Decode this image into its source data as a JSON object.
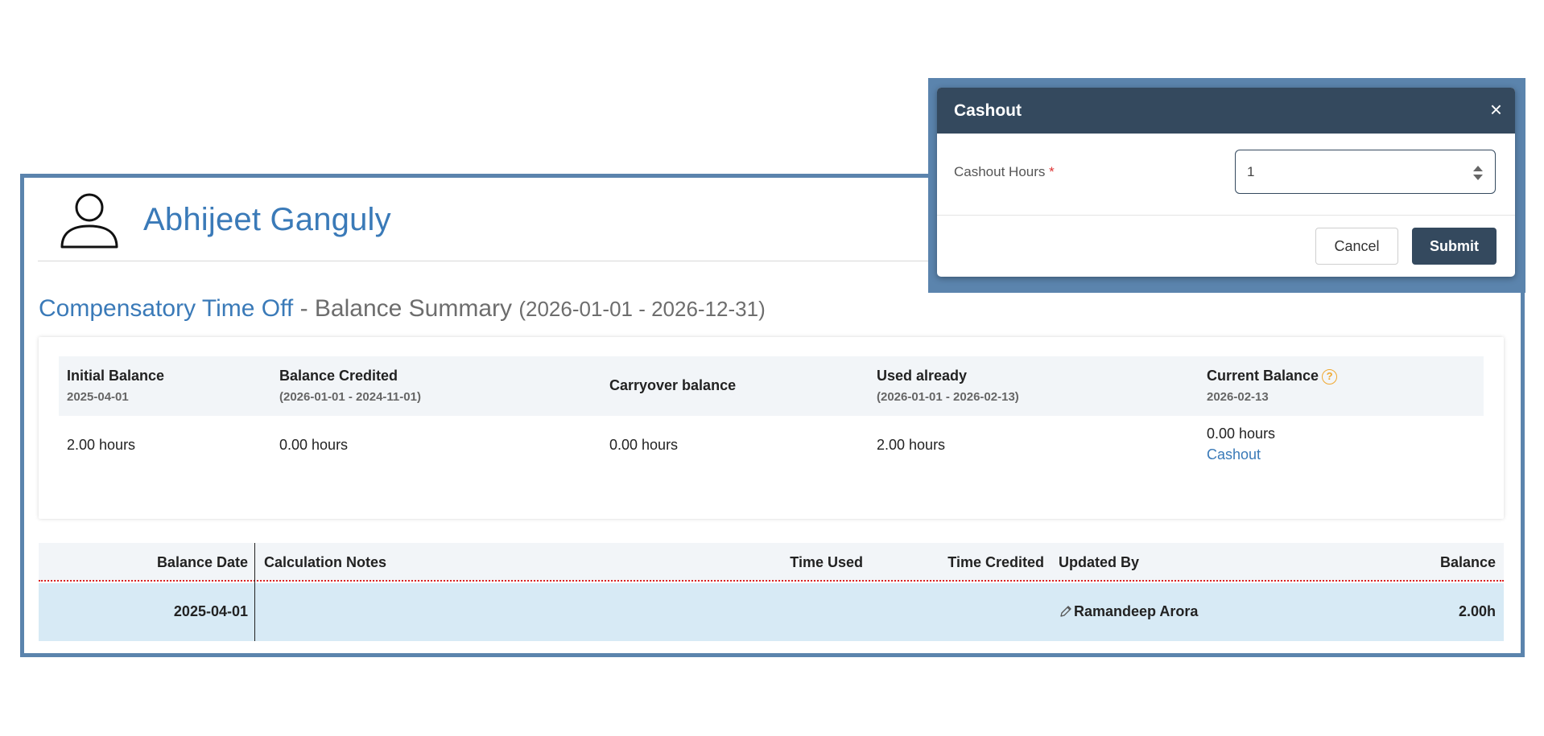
{
  "profile": {
    "name": "Abhijeet Ganguly",
    "avatar_icon": "user-outline-icon"
  },
  "section": {
    "title_link": "Compensatory Time Off",
    "title_rest": " - Balance Summary ",
    "date_range": "(2026-01-01 - 2026-12-31)"
  },
  "summary": {
    "columns": [
      {
        "label": "Initial Balance",
        "sub": "2025-04-01",
        "value": "2.00 hours"
      },
      {
        "label": "Balance Credited",
        "sub": "(2026-01-01 - 2024-11-01)",
        "value": "0.00 hours"
      },
      {
        "label": "Carryover balance",
        "sub": "",
        "value": "0.00 hours"
      },
      {
        "label": "Used already",
        "sub": "(2026-01-01 - 2026-02-13)",
        "value": "2.00 hours"
      },
      {
        "label": "Current Balance",
        "sub": "2026-02-13",
        "value": "0.00 hours",
        "help_icon": "?"
      }
    ],
    "cashout_link": "Cashout"
  },
  "table": {
    "headers": [
      "Balance Date",
      "Calculation Notes",
      "Time Used",
      "Time Credited",
      "Updated By",
      "Balance"
    ],
    "rows": [
      {
        "balance_date": "2025-04-01",
        "notes": "",
        "time_used": "",
        "time_credited": "",
        "updated_by": "Ramandeep Arora",
        "balance": "2.00h"
      }
    ]
  },
  "modal": {
    "title": "Cashout",
    "close": "×",
    "field_label": "Cashout Hours",
    "required_mark": "*",
    "hours_value": "1",
    "cancel_label": "Cancel",
    "submit_label": "Submit"
  },
  "colors": {
    "accent_blue": "#3a7ab8",
    "frame_blue": "#5b84ad",
    "modal_header": "#34495e",
    "row_highlight": "#d7eaf5",
    "help_orange": "#f0a830"
  }
}
